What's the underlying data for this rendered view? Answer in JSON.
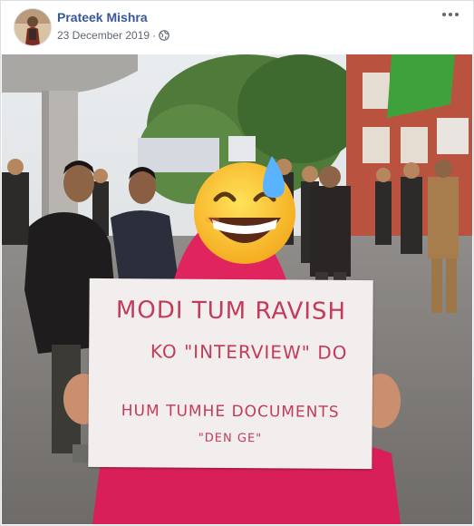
{
  "post": {
    "author_name": "Prateek Mishra",
    "date": "23 December 2019",
    "separator": "·",
    "privacy_icon": "globe-icon",
    "more_icon": "more-options-icon"
  },
  "photo": {
    "sign": {
      "line1": "MODI TUM RAVISH",
      "line2": "KO \"INTERVIEW\" DO",
      "line3": "HUM TUMHE DOCUMENTS",
      "line4": "\"DEN GE\""
    },
    "emoji_overlay": "grinning-sweat-emoji"
  },
  "colors": {
    "author_link": "#385898",
    "meta_text": "#616770",
    "sign_ink": "#c23c5a",
    "scarf": "#e0245e"
  }
}
